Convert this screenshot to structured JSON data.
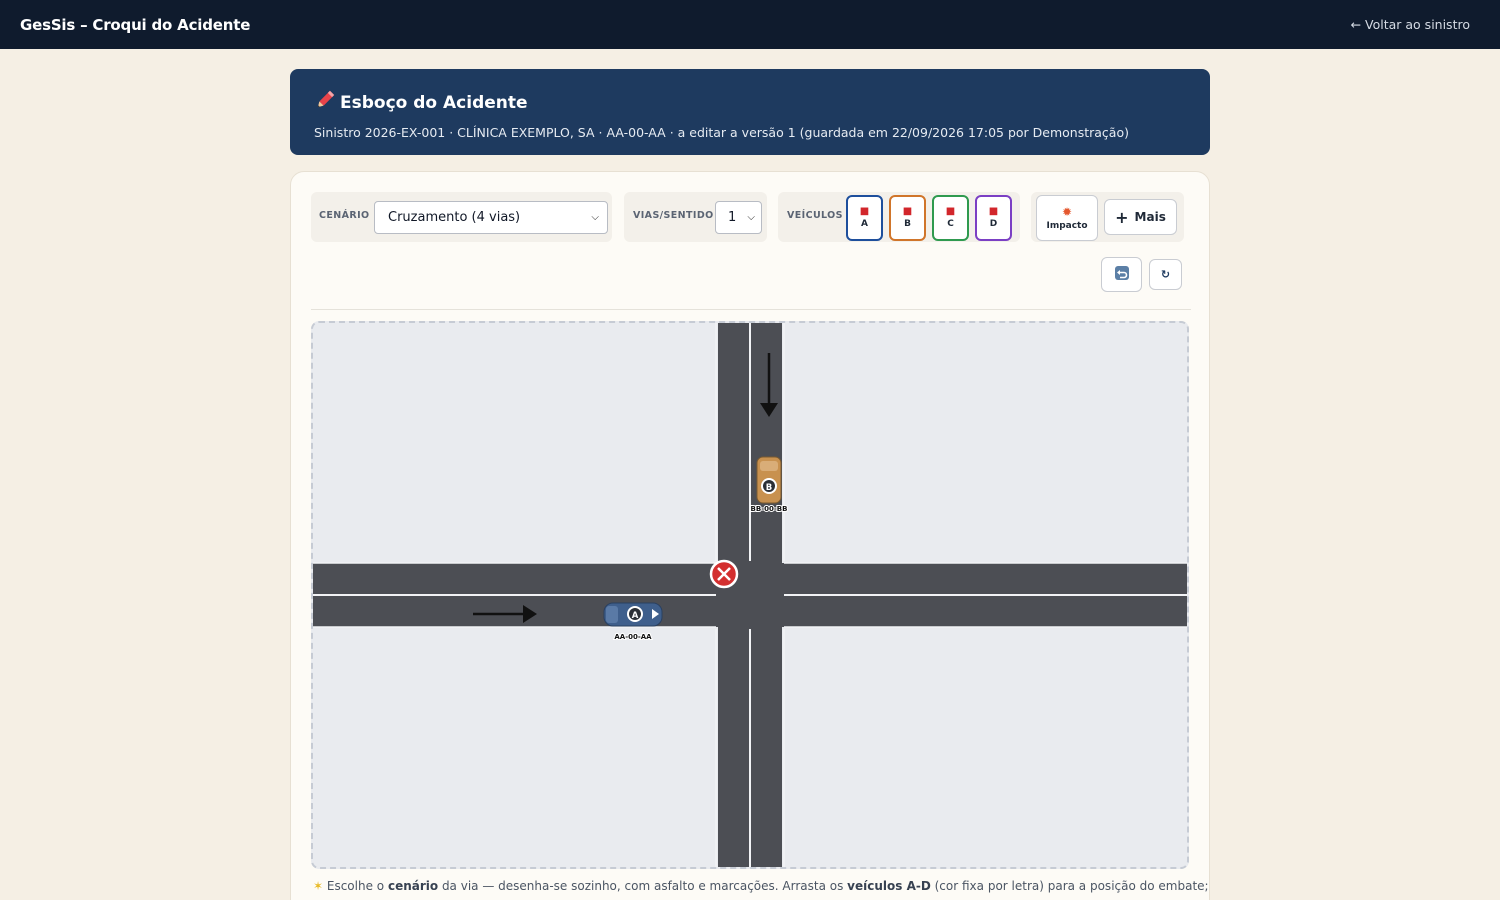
{
  "topbar": {
    "title": "GesSis – Croqui do Acidente",
    "back_label": "← Voltar ao sinistro"
  },
  "header": {
    "icon": "pencil-icon",
    "title": "Esboço do Acidente",
    "subtitle": "Sinistro 2026-EX-001 · CLÍNICA EXEMPLO, SA · AA-00-AA · a editar a versão 1 (guardada em 22/09/2026 17:05 por Demonstração)"
  },
  "toolbar": {
    "scenario_label": "CENÁRIO",
    "scenario_value": "Cruzamento (4 vias)",
    "lanes_label": "VIAS/SENTIDO",
    "lanes_value": "1",
    "vehicles_label": "VEÍCULOS",
    "vehicles": [
      {
        "letter": "A",
        "color": "#1e4f9c"
      },
      {
        "letter": "B",
        "color": "#d0752a"
      },
      {
        "letter": "C",
        "color": "#2f9a4f"
      },
      {
        "letter": "D",
        "color": "#7b3fc4"
      }
    ],
    "impact_label": "Impacto",
    "more_label": "Mais",
    "undo_icon": "undo-icon",
    "redo_icon": "redo-icon",
    "redo_glyph": "↻"
  },
  "sketch": {
    "vehicle_a": {
      "letter": "A",
      "plate": "AA-00-AA",
      "color": "#3f5f8c"
    },
    "vehicle_b": {
      "letter": "B",
      "plate": "BB-00-BB",
      "color": "#c8914f"
    },
    "impact_color": "#d32f2f",
    "road_color": "#4c4e54",
    "background_color": "#e9ebef"
  },
  "hint": {
    "part1": " Escolhe o ",
    "bold1": "cenário",
    "part2": " da via — desenha-se sozinho, com asfalto e marcações. Arrasta os ",
    "bold2": "veículos A-D",
    "part3": " (cor fixa por letra) para a posição do embate;"
  }
}
